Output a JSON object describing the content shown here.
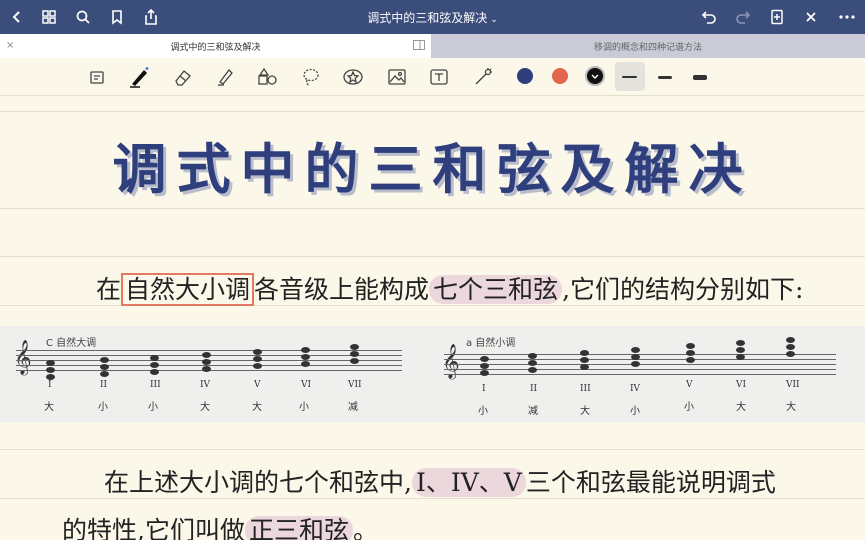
{
  "titlebar": {
    "title": "调式中的三和弦及解决",
    "chevron": "⌄"
  },
  "tabs": [
    {
      "label": "调式中的三和弦及解决",
      "close": "×"
    },
    {
      "label": "移调的概念和四种记谱方法"
    }
  ],
  "colors": {
    "ink_navy": "#2f3e7c",
    "ink_red": "#e2664e",
    "ink_black": "#111111",
    "highlight": "#ecd7dc",
    "box": "#e07a63"
  },
  "note": {
    "heading": "调式中的三和弦及解决",
    "line1": {
      "prefix": "在",
      "boxed": "自然大小调",
      "middle": "各音级上能构成",
      "highlight": "七个三和弦",
      "suffix": ",它们的结构分别如下:"
    },
    "score_major": {
      "title": "C 自然大调",
      "degrees": [
        "I",
        "II",
        "III",
        "IV",
        "V",
        "VI",
        "VII"
      ],
      "qualities": [
        "大",
        "小",
        "小",
        "大",
        "大",
        "小",
        "减"
      ]
    },
    "score_minor": {
      "title": "a 自然小调",
      "degrees": [
        "I",
        "II",
        "III",
        "IV",
        "V",
        "VI",
        "VII"
      ],
      "qualities": [
        "小",
        "减",
        "大",
        "小",
        "小",
        "大",
        "大"
      ]
    },
    "line2": {
      "prefix": "在上述大小调的七个和弦中,",
      "highlight": "I、IV、V",
      "suffix": "三个和弦最能说明调式"
    },
    "line3": {
      "prefix": "的特性,它们叫做",
      "highlight": "正三和弦",
      "suffix": "。"
    }
  }
}
